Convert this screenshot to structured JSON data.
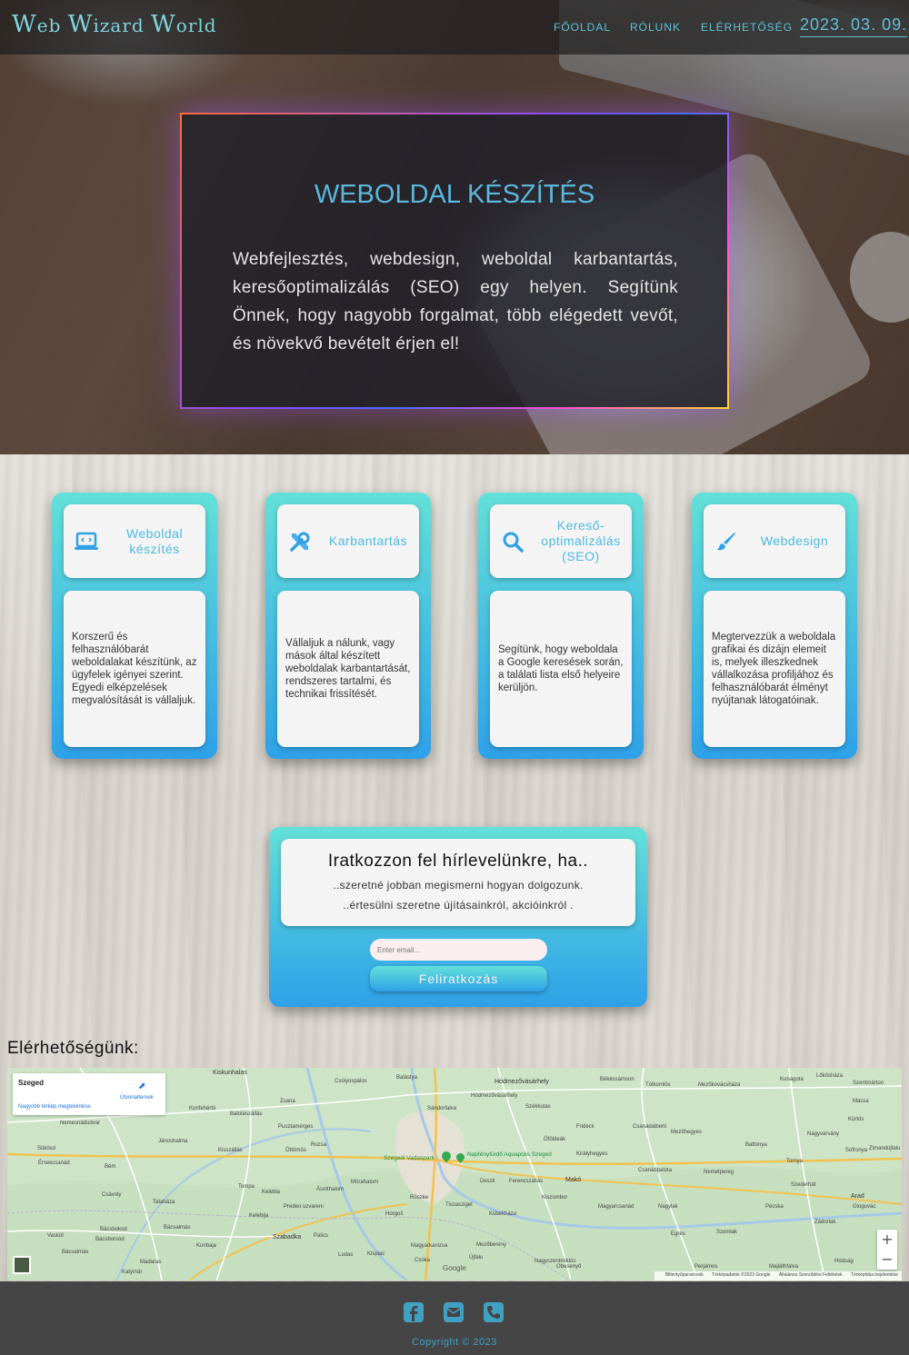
{
  "nav": {
    "logo": {
      "w1": "W",
      "r1": "eb ",
      "w2": "W",
      "r2": "izard ",
      "w3": "W",
      "r3": "orld"
    },
    "links": [
      "FŐOLDAL",
      "RÓLUNK",
      "ELÉRHETŐSÉG"
    ],
    "date": "2023. 03. 09."
  },
  "hero": {
    "title": "WEBOLDAL KÉSZÍTÉS",
    "text": "Webfejlesztés, webdesign, weboldal karbantartás, keresőoptimalizálás (SEO) egy helyen. Segítünk Önnek, hogy nagyobb forgalmat, több elégedett vevőt, és növekvő bevételt érjen el!"
  },
  "services": [
    {
      "icon": "laptop-code-icon",
      "title": "Weboldal készítés",
      "text": "Korszerű és felhasználóbarát weboldalakat készítünk, az ügyfelek igényei szerint. Egyedi elképzelések megvalósítását is vállaljuk."
    },
    {
      "icon": "tools-icon",
      "title": "Karbantartás",
      "text": "Vállaljuk a nálunk, vagy mások által készített weboldalak karbantartását, rendszeres tartalmi, és technikai frissítését."
    },
    {
      "icon": "search-icon",
      "title": "Kereső-optimalizálás (SEO)",
      "text": "Segítünk, hogy weboldala a Google keresések során, a találati lista első helyeire kerüljön."
    },
    {
      "icon": "paint-brush-icon",
      "title": "Webdesign",
      "text": "Megtervezzük a weboldala grafikai és dizájn elemeit is, melyek illeszkednek vállalkozása profiljához és felhasználóbarát élményt nyújtanak látogatóinak."
    }
  ],
  "newsletter": {
    "title": "Iratkozzon fel hírlevelünkre, ha..",
    "line1": "..szeretné jobban megismerni hogyan dolgozunk.",
    "line2": "..értesülni szeretne újításainkról, akcióinkról .",
    "email_placeholder": "Enter email...",
    "button": "Feliratkozás"
  },
  "contact": {
    "title": "Elérhetőségünk:",
    "map": {
      "place": "Szeged",
      "directions": "Útvonaltervek",
      "bigger_map": "Nagyobb térkép megtekintése",
      "zoom_in": "+",
      "zoom_out": "−",
      "google": "Google",
      "footer": [
        "Billentyűparancsok",
        "Térképadatok ©2023 Google",
        "Általános Szerződési Feltételek",
        "Térképhiba bejelentése"
      ],
      "poi1": "Szegedi Vadaspark",
      "poi2": "Napfényfürdő Aquapolis Szeged",
      "labels": [
        "Kiskunhalas",
        "Csólyospálos",
        "Balástya",
        "Hódmezővásárhely",
        "Békéssámson",
        "Tótkomlós",
        "Mezőkovácsháza",
        "Kunágota",
        "Lőkösháza",
        "Szentmárton",
        "Kunfehértó",
        "Zsana",
        "Sándorfalva",
        "Mácsa",
        "Balotaszállás",
        "Pusztamérges",
        "Nemesnádudvar",
        "Csanádalberti",
        "Mezőhegyes",
        "Nagyvarsány",
        "Kürtös",
        "Jánoshalma",
        "Ruzsa",
        "Mórahalom",
        "Röszke",
        "Tiszasziget",
        "Kübekháza",
        "Deszk",
        "Ferencszállás",
        "Makó",
        "Királyhegyes",
        "Battonya",
        "Tornya",
        "Sofronya",
        "Zimandújfalu",
        "Sükösd",
        "Érsekcsanád",
        "Bém",
        "Kisszállás",
        "Öttömös",
        "Ásotthalom",
        "Csanádpalota",
        "Nemetpereg",
        "Szederhát",
        "Arad",
        "Csávoly",
        "Tompa",
        "Kelebia",
        "Kiszombor",
        "Magyarcsanád",
        "Nagylak",
        "Pécska",
        "Glogovác",
        "Vaskút",
        "Bácsbokod",
        "Bácsalmás",
        "Tataháza",
        "Kelebija",
        "Predeo uzvareni",
        "Horgoš",
        "Magyarkanizsa",
        "Egres",
        "Szemlak",
        "Zádorlak",
        "Bácsborsód",
        "Kunbaja",
        "Szabadka",
        "Palics",
        "Kispiac",
        "Nagyszentmiklós",
        "Perjámos",
        "Majláthfalva",
        "Hódság",
        "Madaras",
        "Katymár",
        "Bácsalmás",
        "Obesenyő",
        "Ludas",
        "Csóka",
        "Újfalu",
        "Frideck",
        "Óföldeák",
        "Székkutas",
        "Hódmezővásárhely",
        "Mezőberény"
      ]
    }
  },
  "footer": {
    "icons": [
      "facebook-icon",
      "envelope-icon",
      "phone-icon"
    ],
    "copyright": "Copyright © 2023"
  },
  "colors": {
    "accent": "#5fc3d8",
    "card_top": "#63e0d8",
    "card_bottom": "#2ea1e8",
    "footer_bg": "#454545"
  }
}
